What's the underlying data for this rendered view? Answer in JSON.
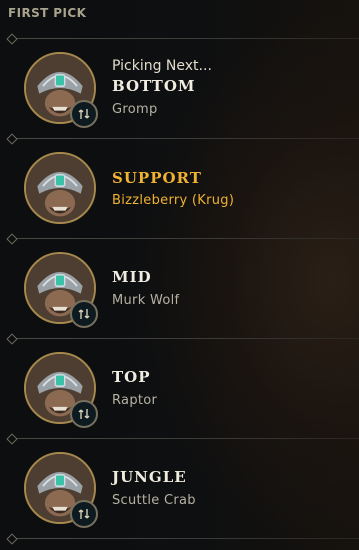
{
  "header": {
    "title": "FIRST PICK"
  },
  "slots": [
    {
      "picking_label": "Picking Next...",
      "role": "BOTTOM",
      "summoner": "Gromp",
      "highlight": false,
      "swap_icon": "swap-arrows-icon"
    },
    {
      "picking_label": "",
      "role": "SUPPORT",
      "summoner": "Bizzleberry (Krug)",
      "highlight": true,
      "swap_icon": ""
    },
    {
      "picking_label": "",
      "role": "MID",
      "summoner": "Murk Wolf",
      "highlight": false,
      "swap_icon": "swap-arrows-icon"
    },
    {
      "picking_label": "",
      "role": "TOP",
      "summoner": "Raptor",
      "highlight": false,
      "swap_icon": "swap-arrows-icon"
    },
    {
      "picking_label": "",
      "role": "JUNGLE",
      "summoner": "Scuttle Crab",
      "highlight": false,
      "swap_icon": "swap-arrows-icon"
    }
  ],
  "colors": {
    "gold_highlight": "#f0b232",
    "avatar_border": "#a8894d"
  }
}
